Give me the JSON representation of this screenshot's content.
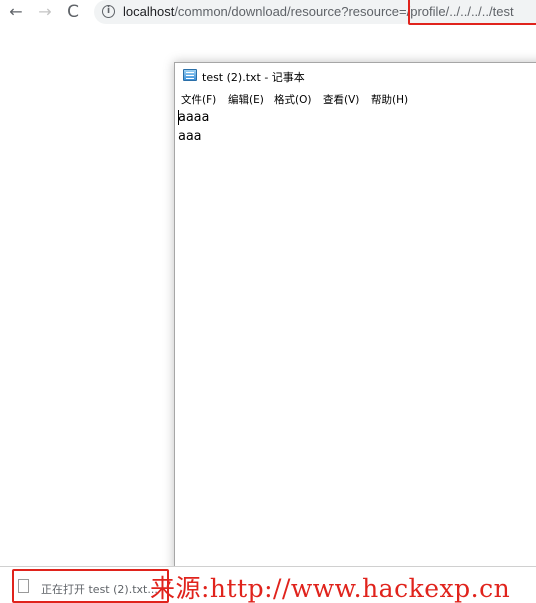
{
  "browser": {
    "back_icon": "←",
    "forward_icon": "→",
    "reload_icon": "C",
    "info_icon": "i",
    "url_base": "localhost",
    "url_path": "/common/download/resource?resource",
    "url_highlighted": "=/profile/../../../../test"
  },
  "notepad": {
    "title": "test (2).txt - 记事本",
    "menu": [
      "文件(F)",
      "编辑(E)",
      "格式(O)",
      "查看(V)",
      "帮助(H)"
    ],
    "lines": [
      "aaaa",
      "aaa"
    ]
  },
  "download_bar": {
    "item_label": "正在打开 test (2).txt..."
  },
  "watermark": "来源:http://www.hackexp.cn",
  "colors": {
    "highlight_border": "#e0231c",
    "watermark": "#e0231c"
  }
}
